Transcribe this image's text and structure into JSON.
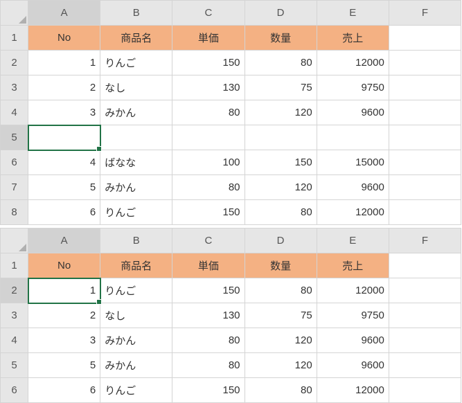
{
  "columns": [
    "A",
    "B",
    "C",
    "D",
    "E",
    "F"
  ],
  "table1": {
    "selectedCell": "A5",
    "rows": [
      "1",
      "2",
      "3",
      "4",
      "5",
      "6",
      "7",
      "8"
    ],
    "headers": [
      "No",
      "商品名",
      "単価",
      "数量",
      "売上"
    ],
    "data": [
      {
        "no": "1",
        "name": "りんご",
        "price": "150",
        "qty": "80",
        "sales": "12000"
      },
      {
        "no": "2",
        "name": "なし",
        "price": "130",
        "qty": "75",
        "sales": "9750"
      },
      {
        "no": "3",
        "name": "みかん",
        "price": "80",
        "qty": "120",
        "sales": "9600"
      },
      null,
      {
        "no": "4",
        "name": "ばなな",
        "price": "100",
        "qty": "150",
        "sales": "15000"
      },
      {
        "no": "5",
        "name": "みかん",
        "price": "80",
        "qty": "120",
        "sales": "9600"
      },
      {
        "no": "6",
        "name": "りんご",
        "price": "150",
        "qty": "80",
        "sales": "12000"
      }
    ]
  },
  "table2": {
    "selectedCell": "A2",
    "rows": [
      "1",
      "2",
      "3",
      "4",
      "5",
      "6"
    ],
    "headers": [
      "No",
      "商品名",
      "単価",
      "数量",
      "売上"
    ],
    "data": [
      {
        "no": "1",
        "name": "りんご",
        "price": "150",
        "qty": "80",
        "sales": "12000"
      },
      {
        "no": "2",
        "name": "なし",
        "price": "130",
        "qty": "75",
        "sales": "9750"
      },
      {
        "no": "3",
        "name": "みかん",
        "price": "80",
        "qty": "120",
        "sales": "9600"
      },
      {
        "no": "5",
        "name": "みかん",
        "price": "80",
        "qty": "120",
        "sales": "9600"
      },
      {
        "no": "6",
        "name": "りんご",
        "price": "150",
        "qty": "80",
        "sales": "12000"
      }
    ]
  }
}
